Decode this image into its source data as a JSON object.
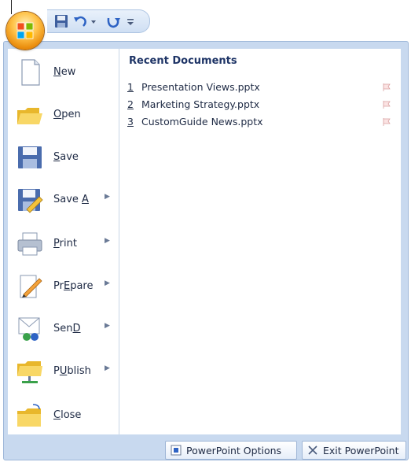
{
  "quick_access": {
    "icons": [
      "save-icon",
      "undo-icon",
      "dropdown-arrow-icon",
      "redo-icon",
      "customize-icon"
    ]
  },
  "menu": {
    "items": [
      {
        "label": "New",
        "mnemonic": "N",
        "has_submenu": false
      },
      {
        "label": "Open",
        "mnemonic": "O",
        "has_submenu": false
      },
      {
        "label": "Save",
        "mnemonic": "S",
        "has_submenu": false
      },
      {
        "label": "Save As",
        "mnemonic": "A",
        "has_submenu": true
      },
      {
        "label": "Print",
        "mnemonic": "P",
        "has_submenu": true
      },
      {
        "label": "Prepare",
        "mnemonic": "E",
        "has_submenu": true
      },
      {
        "label": "Send",
        "mnemonic": "D",
        "has_submenu": true
      },
      {
        "label": "Publish",
        "mnemonic": "U",
        "has_submenu": true
      },
      {
        "label": "Close",
        "mnemonic": "C",
        "has_submenu": false
      }
    ]
  },
  "recent": {
    "title": "Recent Documents",
    "documents": [
      {
        "num": "1",
        "name": "Presentation Views.pptx"
      },
      {
        "num": "2",
        "name": "Marketing Strategy.pptx"
      },
      {
        "num": "3",
        "name": "CustomGuide News.pptx"
      }
    ]
  },
  "footer": {
    "options_label": "PowerPoint Options",
    "exit_label": "Exit PowerPoint"
  }
}
